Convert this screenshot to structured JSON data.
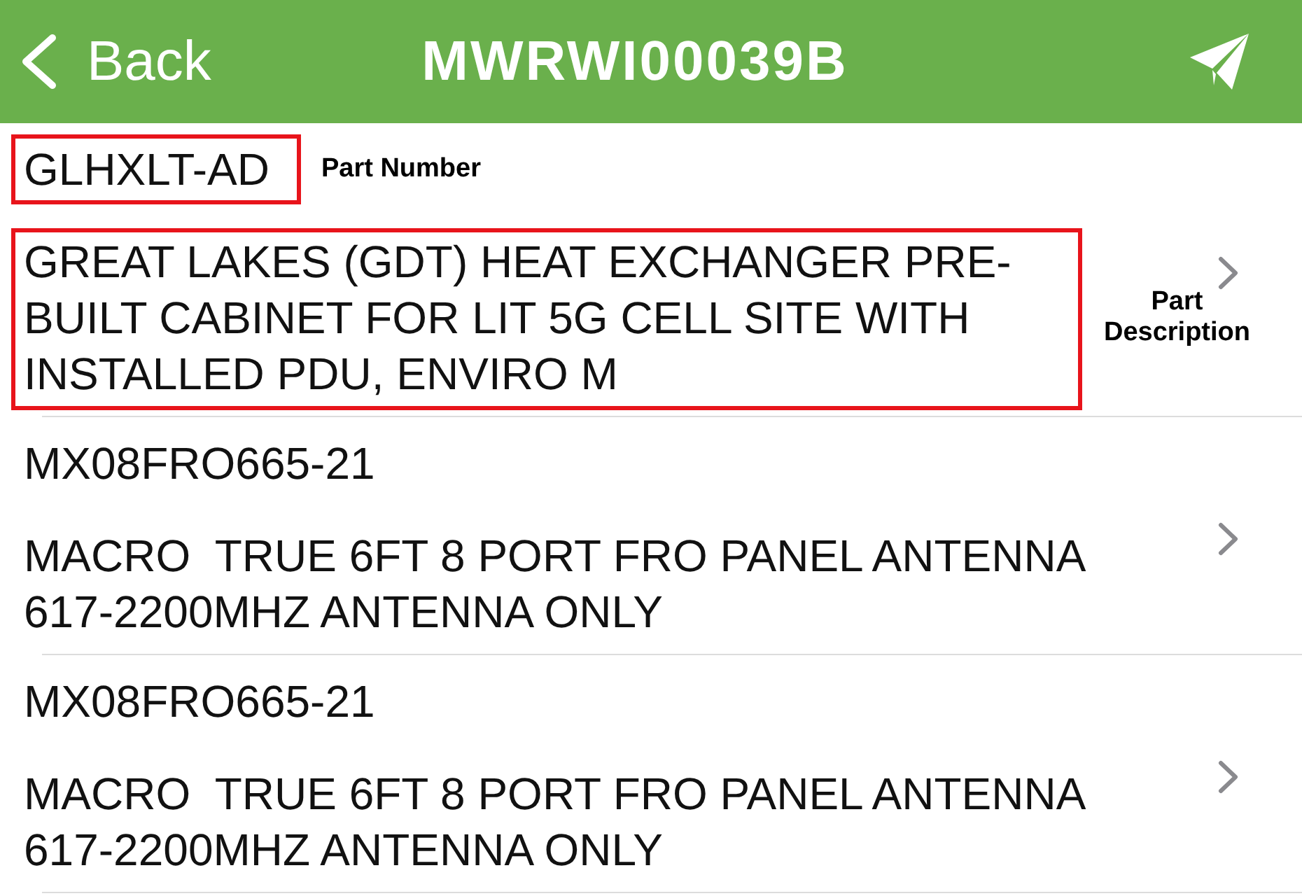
{
  "header": {
    "back_label": "Back",
    "title": "MWRWI00039B"
  },
  "items": [
    {
      "part_number": {
        "text": "GLHXLT-AD",
        "highlighted": true,
        "callout": "Part Number"
      },
      "description": {
        "text": "GREAT LAKES (GDT) HEAT EXCHANGER PRE-BUILT CABINET FOR LIT 5G CELL SITE WITH INSTALLED PDU, ENVIRO M",
        "highlighted": true,
        "callout": "Part Description"
      }
    },
    {
      "part_number": {
        "text": "MX08FRO665-21",
        "highlighted": false
      },
      "description": {
        "text": "MACRO  TRUE 6FT 8 PORT FRO PANEL ANTENNA 617-2200MHZ ANTENNA ONLY",
        "highlighted": false
      }
    },
    {
      "part_number": {
        "text": "MX08FRO665-21",
        "highlighted": false
      },
      "description": {
        "text": "MACRO  TRUE 6FT 8 PORT FRO PANEL ANTENNA 617-2200MHZ ANTENNA ONLY",
        "highlighted": false
      }
    }
  ]
}
